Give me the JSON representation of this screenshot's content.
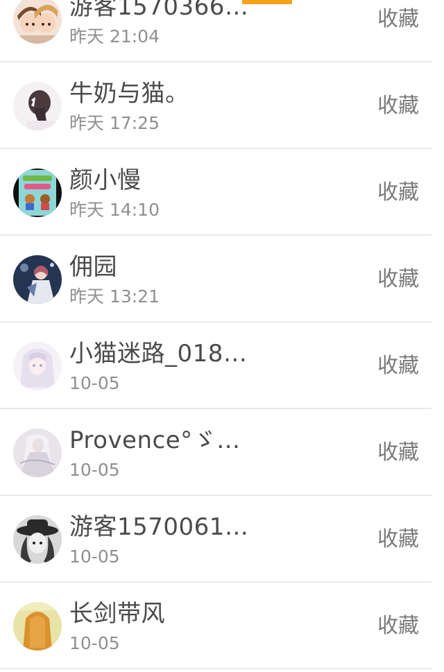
{
  "top_accent_color": "#f7a21b",
  "items": [
    {
      "name": "游客1570366…",
      "time": "昨天 21:04",
      "action": "收藏",
      "avatar_icon": "cartoon-couple-avatar-icon"
    },
    {
      "name": "牛奶与猫。",
      "time": "昨天 17:25",
      "action": "收藏",
      "avatar_icon": "girl-with-bow-avatar-icon"
    },
    {
      "name": "颜小慢",
      "time": "昨天 14:10",
      "action": "收藏",
      "avatar_icon": "book-cover-avatar-icon"
    },
    {
      "name": "佣园",
      "time": "昨天 13:21",
      "action": "收藏",
      "avatar_icon": "night-girl-avatar-icon"
    },
    {
      "name": "小猫迷路_018…",
      "time": "10-05",
      "action": "收藏",
      "avatar_icon": "white-hair-girl-avatar-icon"
    },
    {
      "name": "Provence°ゞ…",
      "time": "10-05",
      "action": "收藏",
      "avatar_icon": "bride-sketch-avatar-icon"
    },
    {
      "name": "游客1570061…",
      "time": "10-05",
      "action": "收藏",
      "avatar_icon": "hat-girl-avatar-icon"
    },
    {
      "name": "长剑带风",
      "time": "10-05",
      "action": "收藏",
      "avatar_icon": "blonde-girl-avatar-icon"
    }
  ]
}
